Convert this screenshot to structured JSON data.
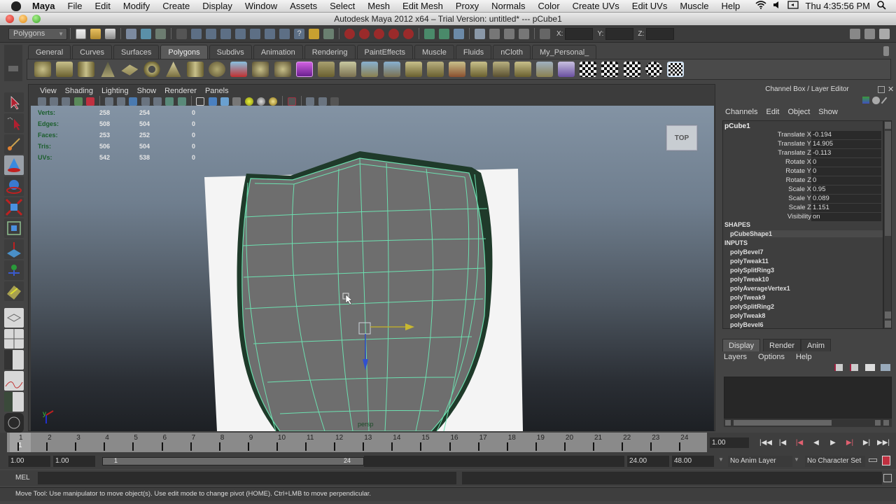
{
  "mac_menubar": {
    "app_name": "Maya",
    "items": [
      "File",
      "Edit",
      "Modify",
      "Create",
      "Display",
      "Window",
      "Assets",
      "Select",
      "Mesh",
      "Edit Mesh",
      "Proxy",
      "Normals",
      "Color",
      "Create UVs",
      "Edit UVs",
      "Muscle",
      "Help"
    ],
    "clock": "Thu 4:35:56 PM"
  },
  "window": {
    "title": "Autodesk Maya 2012 x64 – Trial Version: untitled*   ---   pCube1"
  },
  "status_line": {
    "menu_set": "Polygons",
    "x_label": "X:",
    "y_label": "Y:",
    "z_label": "Z:"
  },
  "shelf": {
    "tabs": [
      "General",
      "Curves",
      "Surfaces",
      "Polygons",
      "Subdivs",
      "Animation",
      "Rendering",
      "PaintEffects",
      "Muscle",
      "Fluids",
      "nCloth",
      "My_Personal_"
    ],
    "active_tab": "Polygons"
  },
  "panel": {
    "menus": [
      "View",
      "Shading",
      "Lighting",
      "Show",
      "Renderer",
      "Panels"
    ],
    "camera": "persp",
    "viewcube_label": "TOP"
  },
  "hud": {
    "rows": [
      {
        "label": "Verts:",
        "a": "258",
        "b": "254",
        "c": "0"
      },
      {
        "label": "Edges:",
        "a": "508",
        "b": "504",
        "c": "0"
      },
      {
        "label": "Faces:",
        "a": "253",
        "b": "252",
        "c": "0"
      },
      {
        "label": "Tris:",
        "a": "506",
        "b": "504",
        "c": "0"
      },
      {
        "label": "UVs:",
        "a": "542",
        "b": "538",
        "c": "0"
      }
    ]
  },
  "channel_box": {
    "title": "Channel Box / Layer Editor",
    "menus": [
      "Channels",
      "Edit",
      "Object",
      "Show"
    ],
    "object": "pCube1",
    "attributes": [
      {
        "name": "Translate X",
        "value": "-0.194"
      },
      {
        "name": "Translate Y",
        "value": "14.905"
      },
      {
        "name": "Translate Z",
        "value": "-0.113"
      },
      {
        "name": "Rotate X",
        "value": "0"
      },
      {
        "name": "Rotate Y",
        "value": "0"
      },
      {
        "name": "Rotate Z",
        "value": "0"
      },
      {
        "name": "Scale X",
        "value": "0.95"
      },
      {
        "name": "Scale Y",
        "value": "0.089"
      },
      {
        "name": "Scale Z",
        "value": "1.151"
      },
      {
        "name": "Visibility",
        "value": "on"
      }
    ],
    "shapes_header": "SHAPES",
    "shapes": [
      "pCubeShape1"
    ],
    "inputs_header": "INPUTS",
    "inputs": [
      "polyBevel7",
      "polyTweak11",
      "polySplitRing3",
      "polyTweak10",
      "polyAverageVertex1",
      "polyTweak9",
      "polySplitRing2",
      "polyTweak8",
      "polyBevel6"
    ]
  },
  "layer_editor": {
    "tabs": [
      "Display",
      "Render",
      "Anim"
    ],
    "active_tab": "Display",
    "menus": [
      "Layers",
      "Options",
      "Help"
    ]
  },
  "time_slider": {
    "frames": [
      1,
      2,
      3,
      4,
      5,
      6,
      7,
      8,
      9,
      10,
      11,
      12,
      13,
      14,
      15,
      16,
      17,
      18,
      19,
      20,
      21,
      22,
      23,
      24
    ],
    "current_frame_marker": "1",
    "current_time": "1.00"
  },
  "range_slider": {
    "start_time": "1.00",
    "playback_start": "1.00",
    "range_start_label": "1",
    "range_end_label": "24",
    "playback_end": "24.00",
    "end_time": "48.00",
    "anim_layer": "No Anim Layer",
    "character_set": "No Character Set"
  },
  "command_line": {
    "label": "MEL"
  },
  "help_line": {
    "text": "Move Tool: Use manipulator to move object(s). Use edit mode to change pivot (HOME).  Ctrl+LMB to move perpendicular."
  }
}
